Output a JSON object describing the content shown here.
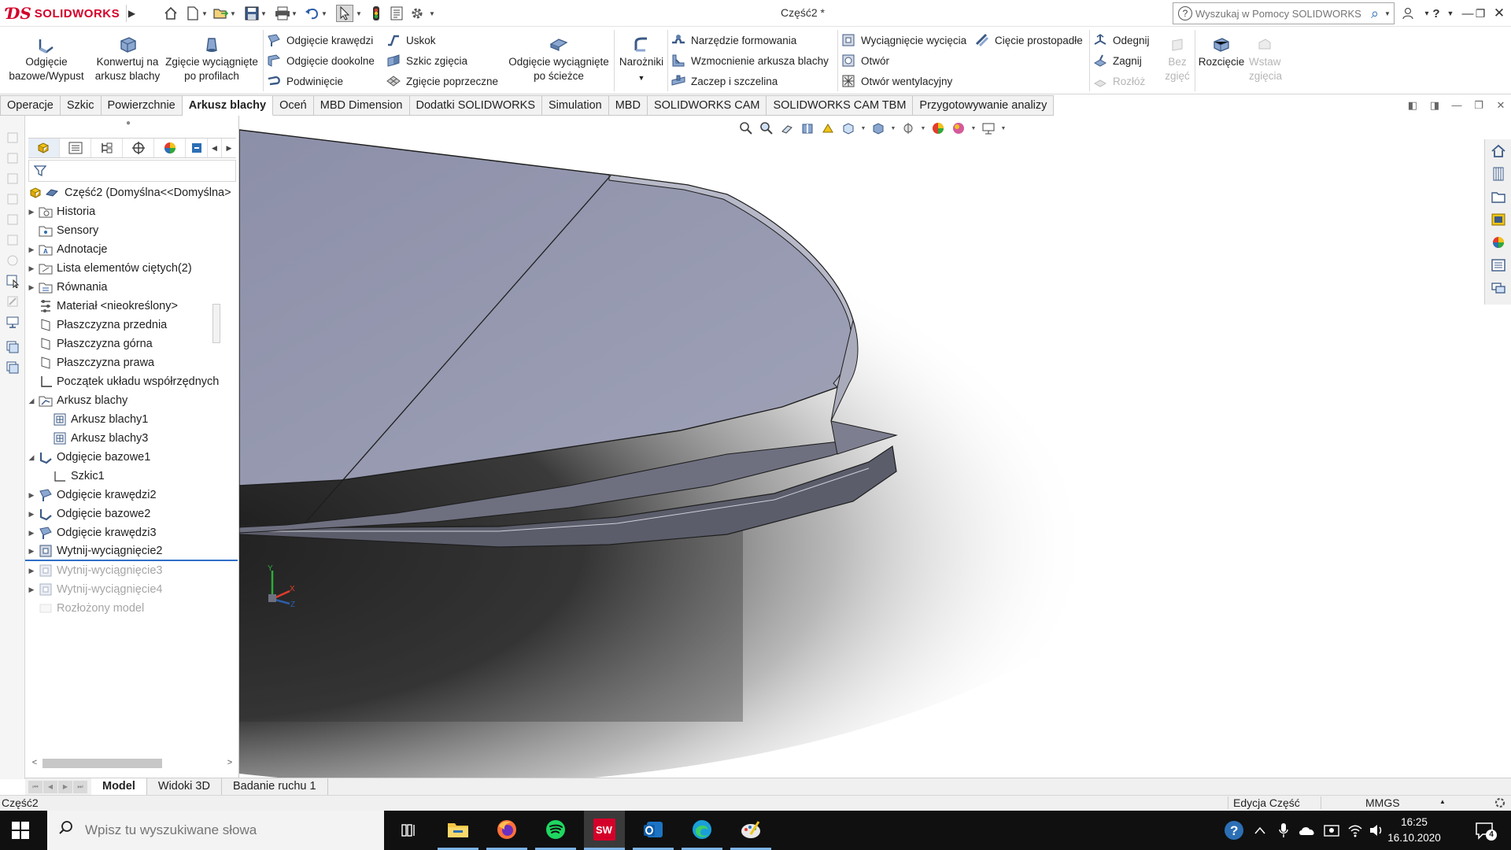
{
  "app": {
    "brand": "SOLIDWORKS",
    "document_title": "Część2 *"
  },
  "quick_access": [
    "home-icon",
    "new-doc-icon",
    "open-icon",
    "save-icon",
    "print-icon",
    "undo-icon",
    "select-icon",
    "rebuild-icon",
    "file-properties-icon",
    "options-icon"
  ],
  "help_search": {
    "placeholder": "Wyszukaj w Pomocy SOLIDWORKS"
  },
  "ribbon": {
    "base_flange": "Odgięcie bazowe/Wypust",
    "convert_sheet_metal": "Konwertuj na arkusz blachy",
    "lofted_bend": "Zgięcie wyciągnięte po profilach",
    "edge_flange": "Odgięcie krawędzi",
    "miter_flange": "Odgięcie dookolne",
    "hem": "Podwinięcie",
    "jog": "Uskok",
    "sketched_bend": "Szkic zgięcia",
    "cross_break": "Zgięcie poprzeczne",
    "swept_flange": "Odgięcie wyciągnięte po ścieżce",
    "corners": "Narożniki",
    "forming_tool": "Narzędzie formowania",
    "gusset": "Wzmocnienie arkusza blachy",
    "tab_slot": "Zaczep i szczelina",
    "extruded_cut": "Wyciągnięcie wycięcia",
    "hole": "Otwór",
    "vent": "Otwór wentylacyjny",
    "normal_cut": "Cięcie prostopadłe",
    "unfold": "Odegnij",
    "fold": "Zagnij",
    "flatten_part": "Rozłóż",
    "no_bends": "Bez zgięć",
    "rip": "Rozcięcie",
    "insert_bends": "Wstaw zgięcia"
  },
  "command_tabs": [
    "Operacje",
    "Szkic",
    "Powierzchnie",
    "Arkusz blachy",
    "Oceń",
    "MBD Dimension",
    "Dodatki SOLIDWORKS",
    "Simulation",
    "MBD",
    "SOLIDWORKS CAM",
    "SOLIDWORKS CAM TBM",
    "Przygotowywanie analizy"
  ],
  "active_command_tab": "Arkusz blachy",
  "feature_tree": {
    "root": "Część2  (Domyślna<<Domyślna>",
    "items": [
      {
        "label": "Historia",
        "icon": "history-folder-icon",
        "expandable": true
      },
      {
        "label": "Sensory",
        "icon": "sensors-icon",
        "expandable": false
      },
      {
        "label": "Adnotacje",
        "icon": "annotations-icon",
        "expandable": true
      },
      {
        "label": "Lista elementów ciętych(2)",
        "icon": "cut-list-icon",
        "expandable": true
      },
      {
        "label": "Równania",
        "icon": "equations-icon",
        "expandable": true
      },
      {
        "label": "Materiał <nieokreślony>",
        "icon": "material-icon",
        "expandable": false
      },
      {
        "label": "Płaszczyzna przednia",
        "icon": "plane-icon",
        "expandable": false
      },
      {
        "label": "Płaszczyzna górna",
        "icon": "plane-icon",
        "expandable": false
      },
      {
        "label": "Płaszczyzna prawa",
        "icon": "plane-icon",
        "expandable": false
      },
      {
        "label": "Początek układu współrzędnych",
        "icon": "origin-icon",
        "expandable": false
      },
      {
        "label": "Arkusz blachy",
        "icon": "sheet-metal-folder-icon",
        "expanded": true
      },
      {
        "label": "Arkusz blachy1",
        "icon": "sheet-metal-feature-icon",
        "child": true
      },
      {
        "label": "Arkusz blachy3",
        "icon": "sheet-metal-feature-icon",
        "child": true
      },
      {
        "label": "Odgięcie bazowe1",
        "icon": "base-flange-icon",
        "expanded": true
      },
      {
        "label": "Szkic1",
        "icon": "sketch-icon",
        "child": true
      },
      {
        "label": "Odgięcie krawędzi2",
        "icon": "edge-flange-icon",
        "expandable": true
      },
      {
        "label": "Odgięcie bazowe2",
        "icon": "base-flange-icon",
        "expandable": true
      },
      {
        "label": "Odgięcie krawędzi3",
        "icon": "edge-flange-icon",
        "expandable": true
      },
      {
        "label": "Wytnij-wyciągnięcie2",
        "icon": "extruded-cut-icon",
        "expandable": true,
        "rollback": true
      },
      {
        "label": "Wytnij-wyciągnięcie3",
        "icon": "extruded-cut-icon",
        "expandable": true,
        "suppressed": true
      },
      {
        "label": "Wytnij-wyciągnięcie4",
        "icon": "extruded-cut-icon",
        "expandable": true,
        "suppressed": true
      },
      {
        "label": "Rozłożony model",
        "icon": "flat-pattern-icon",
        "suppressed": true
      }
    ]
  },
  "bottom_tabs": [
    "Model",
    "Widoki 3D",
    "Badanie ruchu 1"
  ],
  "active_bottom_tab": "Model",
  "status_bar": {
    "part": "Część2",
    "mode": "Edycja Część",
    "units": "MMGS"
  },
  "triad": {
    "x": "X",
    "y": "Y",
    "z": "Z"
  },
  "taskbar": {
    "search_placeholder": "Wpisz tu wyszukiwane słowa",
    "apps": [
      "task-view-icon",
      "file-explorer-icon",
      "firefox-icon",
      "spotify-icon",
      "solidworks-icon",
      "outlook-icon",
      "edge-icon",
      "paint-icon"
    ],
    "time": "16:25",
    "date": "16.10.2020",
    "notifications": "4"
  },
  "colors": {
    "brand": "#d4002a",
    "part_face": "#9497ae",
    "part_face_light": "#a4a7bb",
    "rollback_bar": "#2f6fc7",
    "taskbar": "#101010"
  }
}
